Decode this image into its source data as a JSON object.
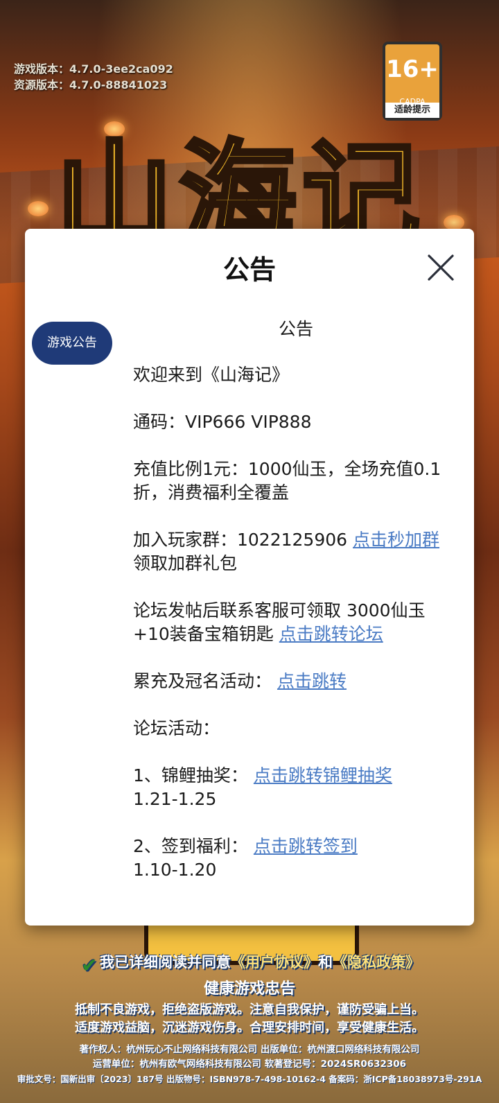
{
  "background": {
    "title_art": "山海记",
    "version": {
      "game_label": "游戏版本：",
      "game_value": "4.7.0-3ee2ca092",
      "res_label": "资源版本：",
      "res_value": "4.7.0-88841023"
    },
    "age_rating": {
      "number": "16+",
      "org": "CADPA",
      "tip": "适龄提示"
    },
    "agreement": {
      "prefix": "我已详细阅读并同意",
      "user_agreement": "《用户协议》",
      "and": "和",
      "privacy_policy": "《隐私政策》"
    },
    "health_notice": {
      "title": "健康游戏忠告",
      "line1": "抵制不良游戏，拒绝盗版游戏。注意自我保护，谨防受骗上当。",
      "line2": "适度游戏益脑，沉迷游戏伤身。合理安排时间，享受健康生活。"
    },
    "copyright": {
      "line1": "著作权人：杭州玩心不止网络科技有限公司  出版单位：杭州渡口网络科技有限公司",
      "line2": "运营单位：杭州有欧气网络科技有限公司  软著登记号：2024SR0632306",
      "line3": "审批文号：国新出审〔2023〕187号 出版物号：ISBN978-7-498-10162-4 备案码：浙ICP备18038973号-291A"
    }
  },
  "modal": {
    "title": "公告",
    "tab_label": "游戏公告",
    "content": {
      "heading": "公告",
      "welcome": "欢迎来到《山海记》",
      "codes": "通码：VIP666 VIP888",
      "recharge": "充值比例1元：1000仙玉，全场充值0.1折，消费福利全覆盖",
      "group_prefix": "加入玩家群：1022125906 ",
      "group_link": "点击秒加群",
      "group_suffix": " 领取加群礼包",
      "forum_prefix": "论坛发帖后联系客服可领取 3000仙玉+10装备宝箱钥匙 ",
      "forum_link": "点击跳转论坛",
      "event_prefix": "累充及冠名活动：  ",
      "event_link": "点击跳转",
      "forum_events": "论坛活动：",
      "lottery_prefix": "1、锦鲤抽奖：  ",
      "lottery_link": "点击跳转锦鲤抽奖",
      "lottery_date": "1.21-1.25",
      "signin_prefix": "2、签到福利：  ",
      "signin_link": "点击跳转签到",
      "signin_date": "1.10-1.20"
    }
  },
  "colors": {
    "tab_bg": "#1f3a78",
    "link": "#4a7bc4"
  },
  "icons": {
    "close": "close-icon",
    "check": "check-icon"
  }
}
